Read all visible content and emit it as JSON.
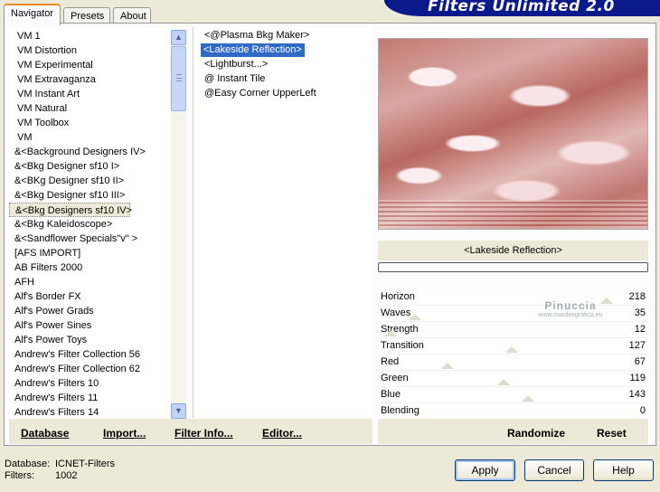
{
  "header": {
    "title": "Filters Unlimited 2.0"
  },
  "tabs": [
    {
      "label": "Navigator",
      "active": true
    },
    {
      "label": "Presets",
      "active": false
    },
    {
      "label": "About",
      "active": false
    }
  ],
  "categories": [
    "VM 1",
    "VM Distortion",
    "VM Experimental",
    "VM Extravaganza",
    "VM Instant Art",
    "VM Natural",
    "VM Toolbox",
    "VM",
    "&<Background Designers IV>",
    "&<Bkg Designer sf10 I>",
    "&<BKg Designer sf10 II>",
    "&<Bkg Designer sf10 III>",
    "&<Bkg Designers sf10 IV>",
    "&<Bkg Kaleidoscope>",
    "&<Sandflower Specials\"v\" >",
    "[AFS IMPORT]",
    "AB Filters 2000",
    "AFH",
    "Alf's Border FX",
    "Alf's Power Grads",
    "Alf's Power Sines",
    "Alf's Power Toys",
    "Andrew's Filter Collection 56",
    "Andrew's Filter Collection 62",
    "Andrew's Filters 10",
    "Andrew's Filters 11",
    "Andrew's Filters 14"
  ],
  "selected_category": "&<Bkg Designers sf10 IV>",
  "filters": [
    "<@Plasma Bkg Maker>",
    "<Lakeside Reflection>",
    "<Lightburst...>",
    "@ Instant Tile",
    "@Easy Corner UpperLeft"
  ],
  "selected_filter": "<Lakeside Reflection>",
  "preview": {
    "filter_name": "<Lakeside Reflection>"
  },
  "watermark": {
    "line1": "Pinuccia",
    "line2": "www.mardiregrafica.eu"
  },
  "parameters": [
    {
      "name": "Horizon",
      "value": "218"
    },
    {
      "name": "Waves",
      "value": "35"
    },
    {
      "name": "Strength",
      "value": "12"
    },
    {
      "name": "Transition",
      "value": "127"
    },
    {
      "name": "Red",
      "value": "67"
    },
    {
      "name": "Green",
      "value": "119"
    },
    {
      "name": "Blue",
      "value": "143"
    },
    {
      "name": "Blending",
      "value": "0"
    }
  ],
  "bottom_links": {
    "database": "Database",
    "import": "Import...",
    "filter_info": "Filter Info...",
    "editor": "Editor...",
    "randomize": "Randomize",
    "reset": "Reset"
  },
  "info": {
    "database_label": "Database:",
    "database_value": "ICNET-Filters",
    "filters_label": "Filters:",
    "filters_value": "1002"
  },
  "buttons": {
    "apply": "Apply",
    "cancel": "Cancel",
    "help": "Help"
  },
  "colors": {
    "banner": "#0b1a8a",
    "selection": "#316ac5",
    "accent_tab": "#e68b2c"
  }
}
